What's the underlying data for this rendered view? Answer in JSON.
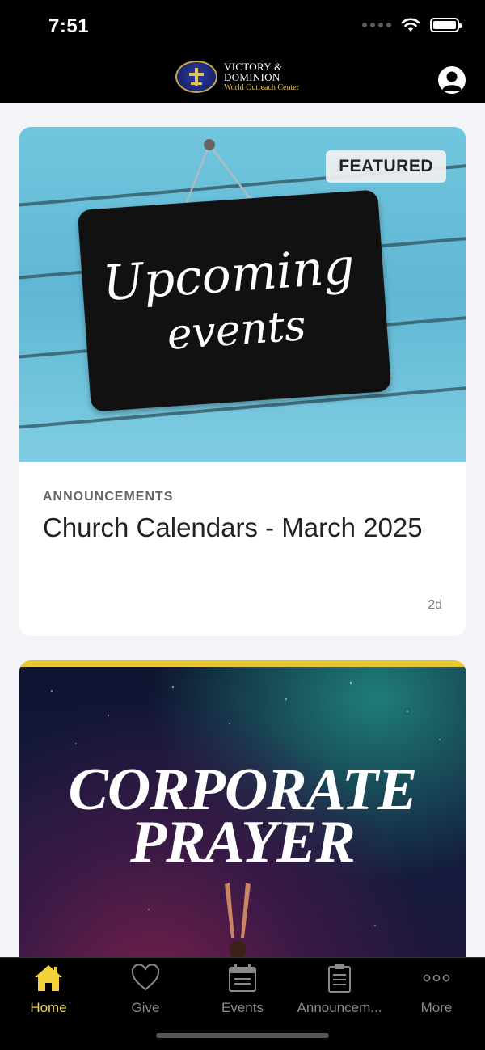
{
  "status_bar": {
    "time": "7:51"
  },
  "header": {
    "logo": {
      "line1": "VICTORY &",
      "line2": "DOMINION",
      "line3": "World Outreach Center"
    }
  },
  "feed": [
    {
      "badge": "FEATURED",
      "image_text": [
        "Upcoming",
        "events"
      ],
      "category": "ANNOUNCEMENTS",
      "title": "Church Calendars - March 2025",
      "age": "2d"
    },
    {
      "image_text": [
        "CORPORATE",
        "PRAYER"
      ]
    }
  ],
  "tabbar": {
    "active": "home",
    "tabs": [
      {
        "label": "Home",
        "icon": "home-icon"
      },
      {
        "label": "Give",
        "icon": "heart-icon"
      },
      {
        "label": "Events",
        "icon": "calendar-icon"
      },
      {
        "label": "Announcem...",
        "icon": "clipboard-icon"
      },
      {
        "label": "More",
        "icon": "more-dots-icon"
      }
    ]
  },
  "colors": {
    "accent": "#f2d33b",
    "header_bg": "#000000",
    "tab_inactive": "#8a8a8a"
  }
}
